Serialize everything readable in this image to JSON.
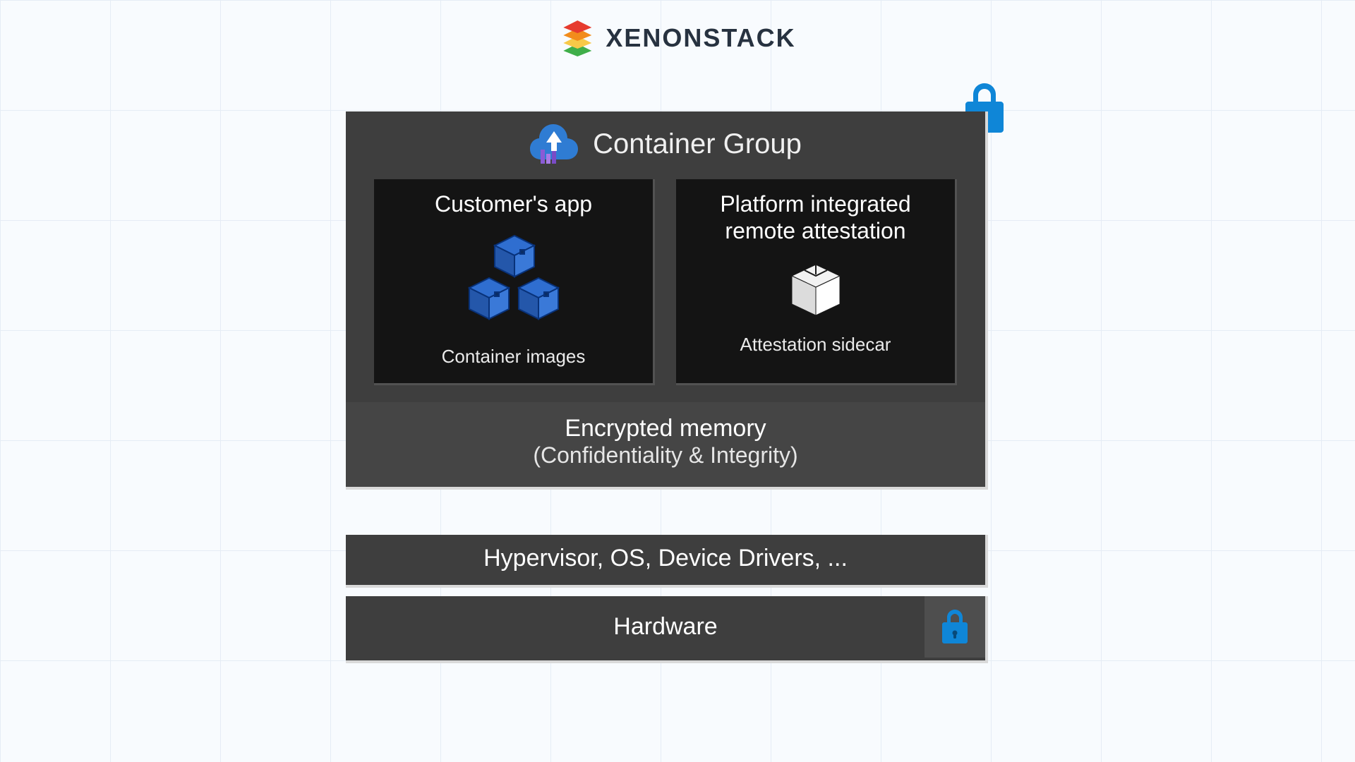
{
  "brand": {
    "name": "XENONSTACK"
  },
  "diagram": {
    "container_group": {
      "title": "Container Group",
      "left_card": {
        "title": "Customer's app",
        "subtitle": "Container images"
      },
      "right_card": {
        "title": "Platform integrated remote attestation",
        "subtitle": "Attestation sidecar"
      }
    },
    "memory": {
      "line1": "Encrypted memory",
      "line2": "(Confidentiality & Integrity)"
    },
    "hypervisor": "Hypervisor, OS, Device Drivers, ...",
    "hardware": "Hardware"
  },
  "icons": {
    "lock": "lock-icon",
    "cloud_upload": "cloud-upload-icon",
    "container_images": "boxes-icon",
    "attestation_cube": "cube-icon",
    "brand_stack": "stack-icon"
  },
  "colors": {
    "panel": "#3e3e3e",
    "card": "#141414",
    "lock_blue": "#0f86d7",
    "box_blue": "#2f6ed0",
    "cloud_blue": "#2f7cd3"
  }
}
